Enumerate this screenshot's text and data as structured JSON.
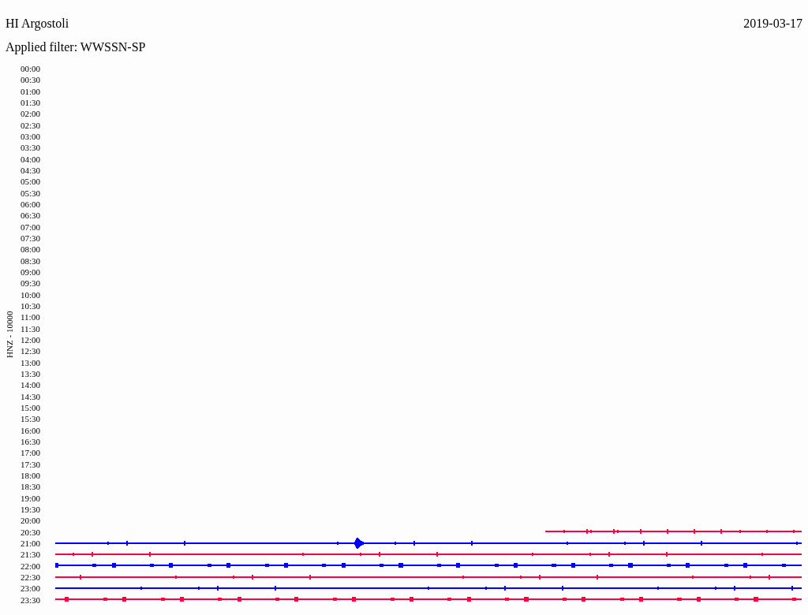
{
  "station": "HI Argostoli",
  "date": "2019-03-17",
  "filter": "Applied filter: WWSSN-SP",
  "axis_label": "HNZ - 10000",
  "rows": [
    {
      "time": "00:00"
    },
    {
      "time": "00:30"
    },
    {
      "time": "01:00"
    },
    {
      "time": "01:30"
    },
    {
      "time": "02:00"
    },
    {
      "time": "02:30"
    },
    {
      "time": "03:00"
    },
    {
      "time": "03:30"
    },
    {
      "time": "04:00"
    },
    {
      "time": "04:30"
    },
    {
      "time": "05:00"
    },
    {
      "time": "05:30"
    },
    {
      "time": "06:00"
    },
    {
      "time": "06:30"
    },
    {
      "time": "07:00"
    },
    {
      "time": "07:30"
    },
    {
      "time": "08:00"
    },
    {
      "time": "08:30"
    },
    {
      "time": "09:00"
    },
    {
      "time": "09:30"
    },
    {
      "time": "10:00"
    },
    {
      "time": "10:30"
    },
    {
      "time": "11:00"
    },
    {
      "time": "11:30"
    },
    {
      "time": "12:00"
    },
    {
      "time": "12:30"
    },
    {
      "time": "13:00"
    },
    {
      "time": "13:30"
    },
    {
      "time": "14:00"
    },
    {
      "time": "14:30"
    },
    {
      "time": "15:00"
    },
    {
      "time": "15:30"
    },
    {
      "time": "16:00"
    },
    {
      "time": "16:30"
    },
    {
      "time": "17:00"
    },
    {
      "time": "17:30"
    },
    {
      "time": "18:00"
    },
    {
      "time": "18:30"
    },
    {
      "time": "19:00"
    },
    {
      "time": "19:30"
    },
    {
      "time": "20:00"
    },
    {
      "time": "20:30",
      "trace": {
        "kind": "partial",
        "color": "#ff0040"
      }
    },
    {
      "time": "21:00",
      "trace": {
        "kind": "event",
        "color": "#0000ff"
      }
    },
    {
      "time": "21:30",
      "trace": {
        "kind": "full",
        "color": "#ff0040"
      }
    },
    {
      "time": "22:00",
      "trace": {
        "kind": "noisy",
        "color": "#0000ff"
      }
    },
    {
      "time": "22:30",
      "trace": {
        "kind": "full",
        "color": "#ff0040"
      }
    },
    {
      "time": "23:00",
      "trace": {
        "kind": "full",
        "color": "#0000ff"
      }
    },
    {
      "time": "23:30",
      "trace": {
        "kind": "noisy",
        "color": "#ff0040"
      }
    }
  ]
}
